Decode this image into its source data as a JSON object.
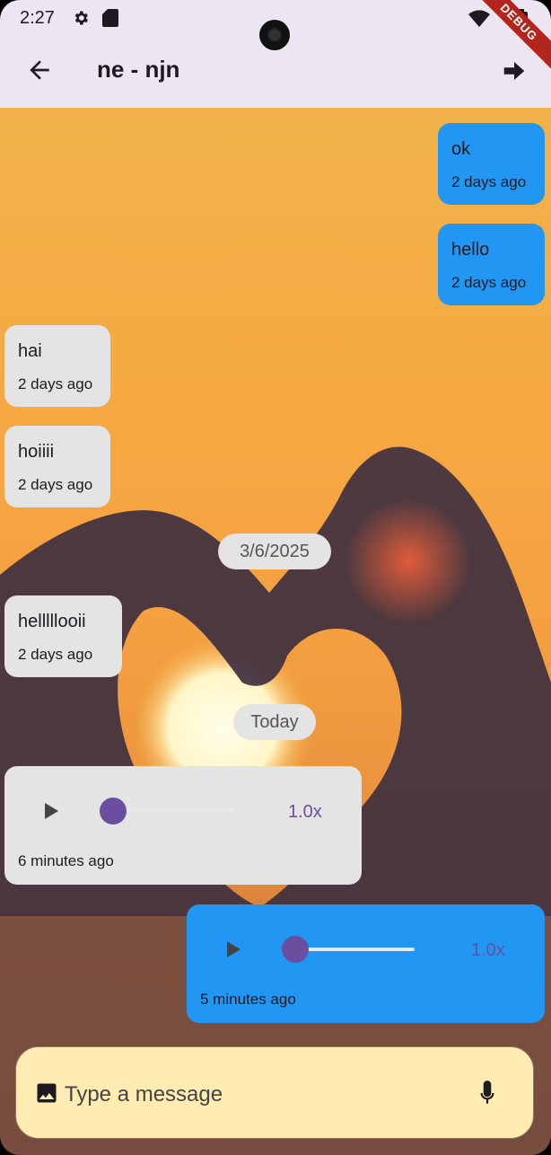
{
  "status": {
    "time": "2:27",
    "debug_label": "DEBUG"
  },
  "header": {
    "title": "ne - njn"
  },
  "messages": [
    {
      "side": "sent",
      "text": "ok",
      "time": "2 days ago"
    },
    {
      "side": "sent",
      "text": "hello",
      "time": "2 days ago"
    },
    {
      "side": "recv",
      "text": "hai",
      "time": "2 days ago"
    },
    {
      "side": "recv",
      "text": "hoiiii",
      "time": "2 days ago"
    },
    {
      "side": "recv",
      "text": "helllllooii",
      "time": "2 days ago"
    }
  ],
  "date_chips": [
    "3/6/2025",
    "Today"
  ],
  "voice_messages": [
    {
      "side": "recv",
      "speed": "1.0x",
      "time": "6 minutes ago",
      "progress": 0
    },
    {
      "side": "sent",
      "speed": "1.0x",
      "time": "5 minutes ago",
      "progress": 0
    }
  ],
  "composer": {
    "placeholder": "Type a message"
  },
  "icons": [
    "settings-icon",
    "sd-card-icon",
    "wifi-icon",
    "battery-icon",
    "back-arrow-icon",
    "forward-arrow-icon",
    "play-icon",
    "image-icon",
    "mic-icon"
  ],
  "colors": {
    "app_bar": "#ece6f3",
    "sent_bubble": "#2196f3",
    "received_bubble": "#e4e4e4",
    "accent": "#6a4fa0",
    "composer": "#ffecb3"
  }
}
